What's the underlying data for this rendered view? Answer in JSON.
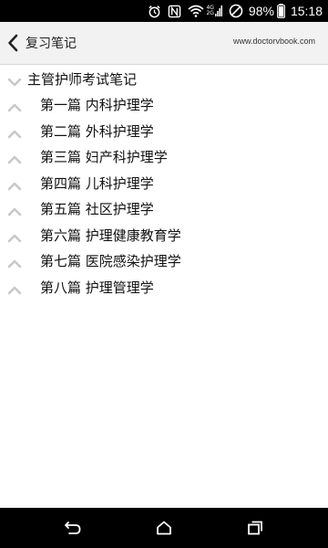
{
  "status_bar": {
    "battery": "98%",
    "time": "15:18",
    "net_top": "4G",
    "net_bottom": "2G",
    "icons": [
      "alarm-icon",
      "nfc-icon",
      "wifi-icon",
      "signal-icon",
      "do-not-disturb-icon",
      "battery-icon"
    ]
  },
  "header": {
    "title": "复习笔记",
    "url": "www.doctorvbook.com",
    "back_icon": "chevron-left-icon"
  },
  "tree": {
    "root": {
      "label": "主管护师考试笔记",
      "icon": "chevron-down-icon"
    },
    "items": [
      {
        "label": "第一篇 内科护理学"
      },
      {
        "label": "第二篇 外科护理学"
      },
      {
        "label": "第三篇 妇产科护理学"
      },
      {
        "label": "第四篇 儿科护理学"
      },
      {
        "label": "第五篇 社区护理学"
      },
      {
        "label": "第六篇 护理健康教育学"
      },
      {
        "label": "第七篇 医院感染护理学"
      },
      {
        "label": "第八篇 护理管理学"
      }
    ],
    "item_icon": "chevron-up-icon"
  },
  "nav_bar": {
    "buttons": [
      "back-nav-icon",
      "home-icon",
      "recent-apps-icon"
    ]
  },
  "colors": {
    "status_bar": "#000000",
    "header_bg": "#f2f2f2",
    "chevron": "#cccccc",
    "nav_bar": "#000000"
  }
}
